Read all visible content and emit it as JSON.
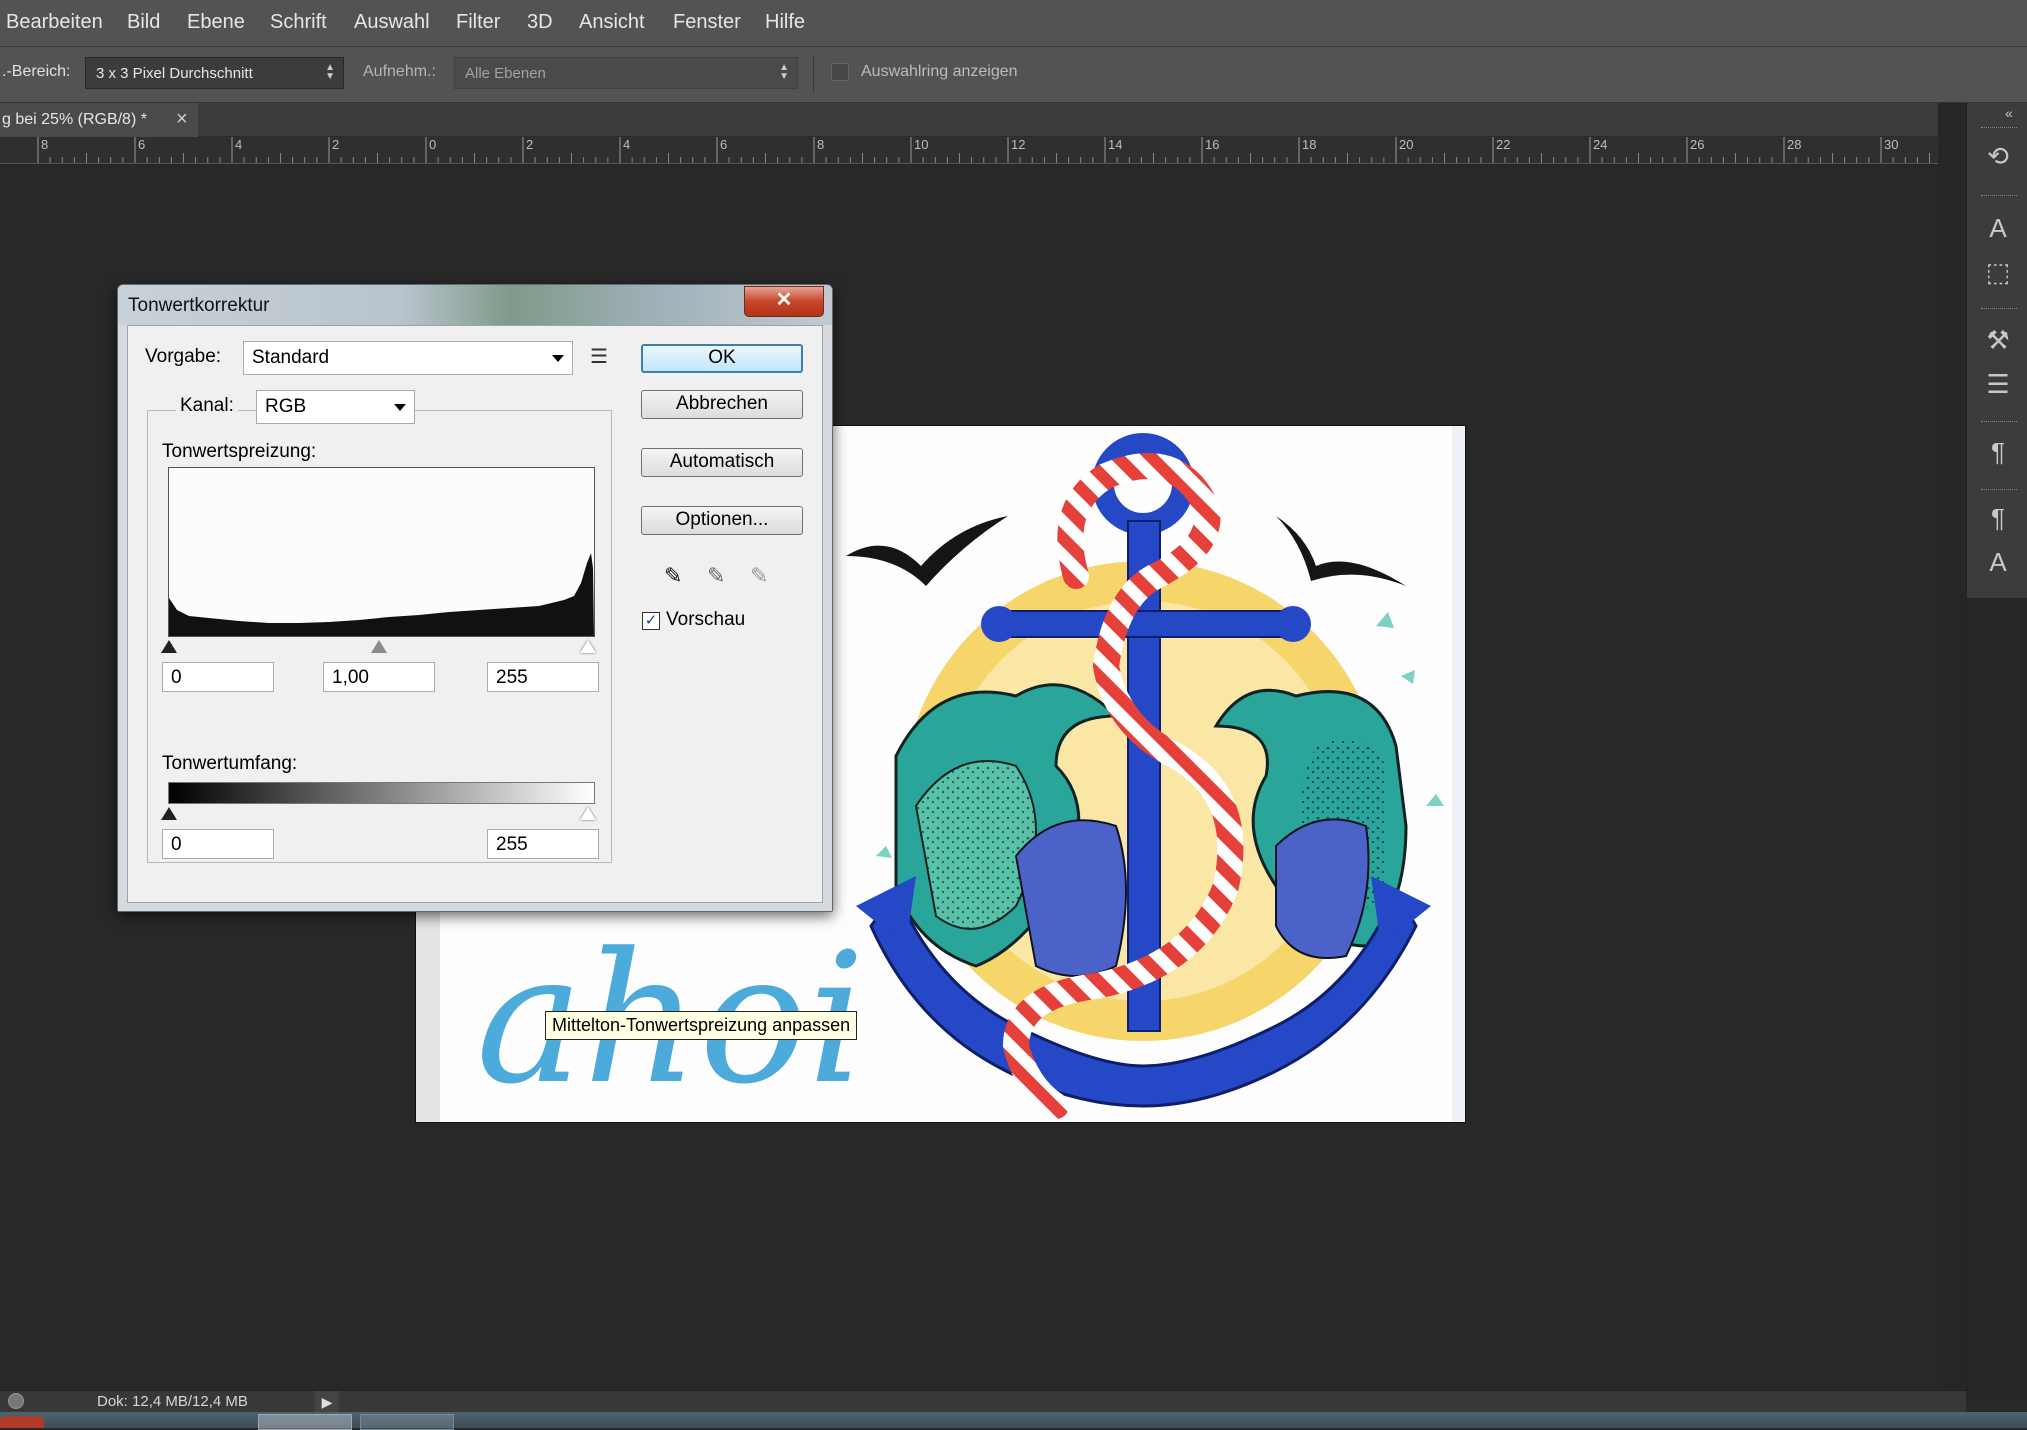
{
  "menubar": {
    "items": [
      "Bearbeiten",
      "Bild",
      "Ebene",
      "Schrift",
      "Auswahl",
      "Filter",
      "3D",
      "Ansicht",
      "Fenster",
      "Hilfe"
    ]
  },
  "options": {
    "sample_label": ".-Bereich:",
    "sample_value": "3 x 3 Pixel Durchschnitt",
    "aufnehm_label": "Aufnehm.:",
    "aufnehm_value": "Alle Ebenen",
    "ring_label": "Auswahlring anzeigen"
  },
  "document_tab": {
    "title": "g bei 25% (RGB/8) *",
    "close_glyph": "×"
  },
  "ruler": {
    "labels": [
      "8",
      "6",
      "4",
      "2",
      "0",
      "2",
      "4",
      "6",
      "8",
      "10",
      "12",
      "14",
      "16",
      "18",
      "20",
      "22",
      "24",
      "26",
      "28",
      "30"
    ]
  },
  "artwork": {
    "lettering": "ahoi"
  },
  "dialog": {
    "title": "Tonwertkorrektur",
    "close_glyph": "✕",
    "preset_label": "Vorgabe:",
    "preset_value": "Standard",
    "channel_label": "Kanal:",
    "channel_value": "RGB",
    "input_levels_label": "Tonwertspreizung:",
    "input_black": "0",
    "input_gamma": "1,00",
    "input_white": "255",
    "output_levels_label": "Tonwertumfang:",
    "output_black": "0",
    "output_white": "255",
    "buttons": {
      "ok": "OK",
      "cancel": "Abbrechen",
      "auto": "Automatisch",
      "options": "Optionen..."
    },
    "preview_label": "Vorschau",
    "preview_checked": true,
    "tooltip": "Mittelton-Tonwertspreizung anpassen"
  },
  "status": {
    "doc_size": "Dok: 12,4 MB/12,4 MB"
  },
  "colors": {
    "chrome": "#535353",
    "canvas_bg": "#282828",
    "dialog_bg": "#f0f0f0",
    "close_red": "#c7452d",
    "ok_border": "#3c7fb1"
  }
}
